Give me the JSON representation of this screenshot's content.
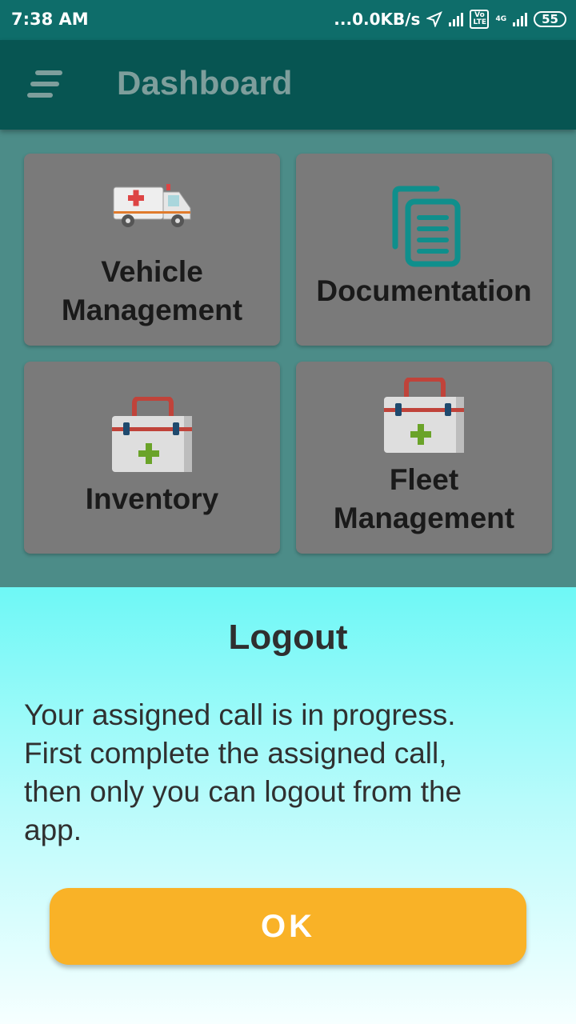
{
  "status_bar": {
    "time": "7:38 AM",
    "net_speed": "...0.0KB/s",
    "volte_label": "Vo LTE",
    "network_label": "4G",
    "battery": "55"
  },
  "app_bar": {
    "title": "Dashboard",
    "menu_icon": "menu-icon"
  },
  "tiles": [
    {
      "label_line1": "Vehicle",
      "label_line2": "Management",
      "icon": "ambulance-icon"
    },
    {
      "label_line1": "Documentation",
      "icon": "documents-icon"
    },
    {
      "label_line1": "Inventory",
      "icon": "first-aid-kit-icon"
    },
    {
      "label_line1": "Fleet",
      "label_line2": "Management",
      "icon": "first-aid-kit-icon"
    }
  ],
  "dialog": {
    "title": "Logout",
    "message_lines": [
      "Your assigned call is in progress.",
      "First complete the assigned call,",
      "then only you can logout from the",
      "app."
    ],
    "ok_label": "OK"
  },
  "colors": {
    "accent": "#f9b227",
    "app_bar": "#075552",
    "teal_icon": "#0f8f8c"
  }
}
